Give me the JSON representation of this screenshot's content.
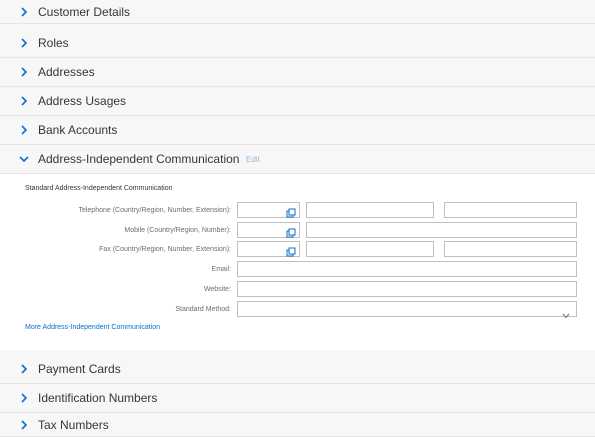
{
  "sections_top": [
    {
      "label": "Customer Details"
    },
    {
      "label": "Roles"
    },
    {
      "label": "Addresses"
    },
    {
      "label": "Address Usages"
    },
    {
      "label": "Bank Accounts"
    }
  ],
  "expanded_section": {
    "label": "Address-Independent Communication",
    "edit_label": "Edit",
    "subheading": "Standard Address-Independent Communication",
    "fields": {
      "telephone_label": "Telephone (Country/Region, Number, Extension):",
      "mobile_label": "Mobile (Country/Region, Number):",
      "fax_label": "Fax (Country/Region, Number, Extension):",
      "email_label": "Email:",
      "website_label": "Website:",
      "standard_method_label": "Standard Method:"
    },
    "more_link": "More Address-Independent Communication"
  },
  "sections_bottom": [
    {
      "label": "Payment Cards"
    },
    {
      "label": "Identification Numbers"
    },
    {
      "label": "Tax Numbers"
    }
  ],
  "colors": {
    "link": "#0a6ed1",
    "edit_disabled": "#9ab8d9",
    "chevron": "#0a6ed1"
  },
  "icons": {
    "collapsed": "chevron-right-icon",
    "expanded": "chevron-down-icon",
    "value_help": "value-help-icon",
    "dropdown": "chevron-down-icon"
  }
}
